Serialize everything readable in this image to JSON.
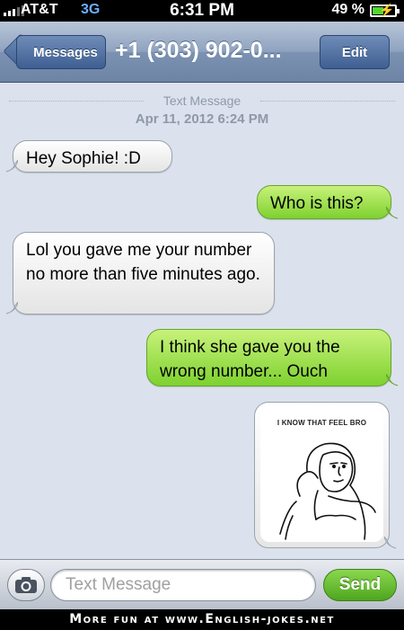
{
  "status_bar": {
    "carrier": "AT&T",
    "network": "3G",
    "time": "6:31 PM",
    "battery_percent": "49 %",
    "battery_level": 0.49
  },
  "nav": {
    "back_label": "Messages",
    "title": "+1 (303) 902-0...",
    "edit_label": "Edit"
  },
  "thread": {
    "header_label": "Text Message",
    "timestamp": "Apr 11, 2012 6:24 PM",
    "messages": [
      {
        "direction": "in",
        "text": "Hey Sophie! :D"
      },
      {
        "direction": "out",
        "text": "Who is this?"
      },
      {
        "direction": "in",
        "text": "Lol you gave me your number no more than five minutes ago."
      },
      {
        "direction": "out",
        "text": "I think she gave you the wrong number... Ouch"
      },
      {
        "direction": "out",
        "type": "image",
        "caption": "I KNOW THAT FEEL BRO"
      }
    ]
  },
  "input_bar": {
    "placeholder": "Text Message",
    "send_label": "Send"
  },
  "footer": {
    "text": "More fun at www.English-jokes.net"
  },
  "colors": {
    "nav_blue": "#6d84a5",
    "thread_bg": "#dbe2ed",
    "outgoing_green": "#7ed130",
    "incoming_white": "#ffffff"
  }
}
